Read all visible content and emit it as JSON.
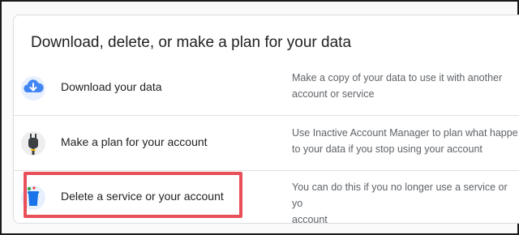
{
  "card": {
    "title": "Download, delete, or make a plan for your data"
  },
  "rows": [
    {
      "label": "Download your data",
      "description": "Make a copy of your data to use it with another\naccount or service",
      "icon": "cloud-download-icon"
    },
    {
      "label": "Make a plan for your account",
      "description": "Use Inactive Account Manager to plan what happe\nto your data if you stop using your account",
      "icon": "power-plug-icon"
    },
    {
      "label": "Delete a service or your account",
      "description": "You can do this if you no longer use a service or yo\naccount",
      "icon": "trash-can-icon"
    }
  ],
  "colors": {
    "highlight": "#e8505a",
    "cloud": "#4285f4",
    "trash": "#1a73e8"
  }
}
